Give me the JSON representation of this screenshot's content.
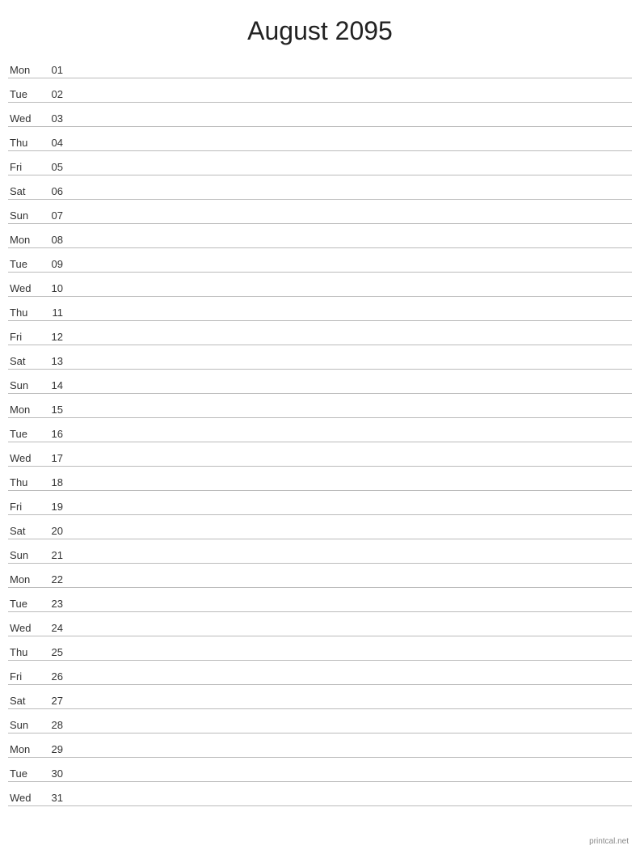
{
  "title": "August 2095",
  "days": [
    {
      "name": "Mon",
      "number": "01"
    },
    {
      "name": "Tue",
      "number": "02"
    },
    {
      "name": "Wed",
      "number": "03"
    },
    {
      "name": "Thu",
      "number": "04"
    },
    {
      "name": "Fri",
      "number": "05"
    },
    {
      "name": "Sat",
      "number": "06"
    },
    {
      "name": "Sun",
      "number": "07"
    },
    {
      "name": "Mon",
      "number": "08"
    },
    {
      "name": "Tue",
      "number": "09"
    },
    {
      "name": "Wed",
      "number": "10"
    },
    {
      "name": "Thu",
      "number": "11"
    },
    {
      "name": "Fri",
      "number": "12"
    },
    {
      "name": "Sat",
      "number": "13"
    },
    {
      "name": "Sun",
      "number": "14"
    },
    {
      "name": "Mon",
      "number": "15"
    },
    {
      "name": "Tue",
      "number": "16"
    },
    {
      "name": "Wed",
      "number": "17"
    },
    {
      "name": "Thu",
      "number": "18"
    },
    {
      "name": "Fri",
      "number": "19"
    },
    {
      "name": "Sat",
      "number": "20"
    },
    {
      "name": "Sun",
      "number": "21"
    },
    {
      "name": "Mon",
      "number": "22"
    },
    {
      "name": "Tue",
      "number": "23"
    },
    {
      "name": "Wed",
      "number": "24"
    },
    {
      "name": "Thu",
      "number": "25"
    },
    {
      "name": "Fri",
      "number": "26"
    },
    {
      "name": "Sat",
      "number": "27"
    },
    {
      "name": "Sun",
      "number": "28"
    },
    {
      "name": "Mon",
      "number": "29"
    },
    {
      "name": "Tue",
      "number": "30"
    },
    {
      "name": "Wed",
      "number": "31"
    }
  ],
  "footer": "printcal.net"
}
